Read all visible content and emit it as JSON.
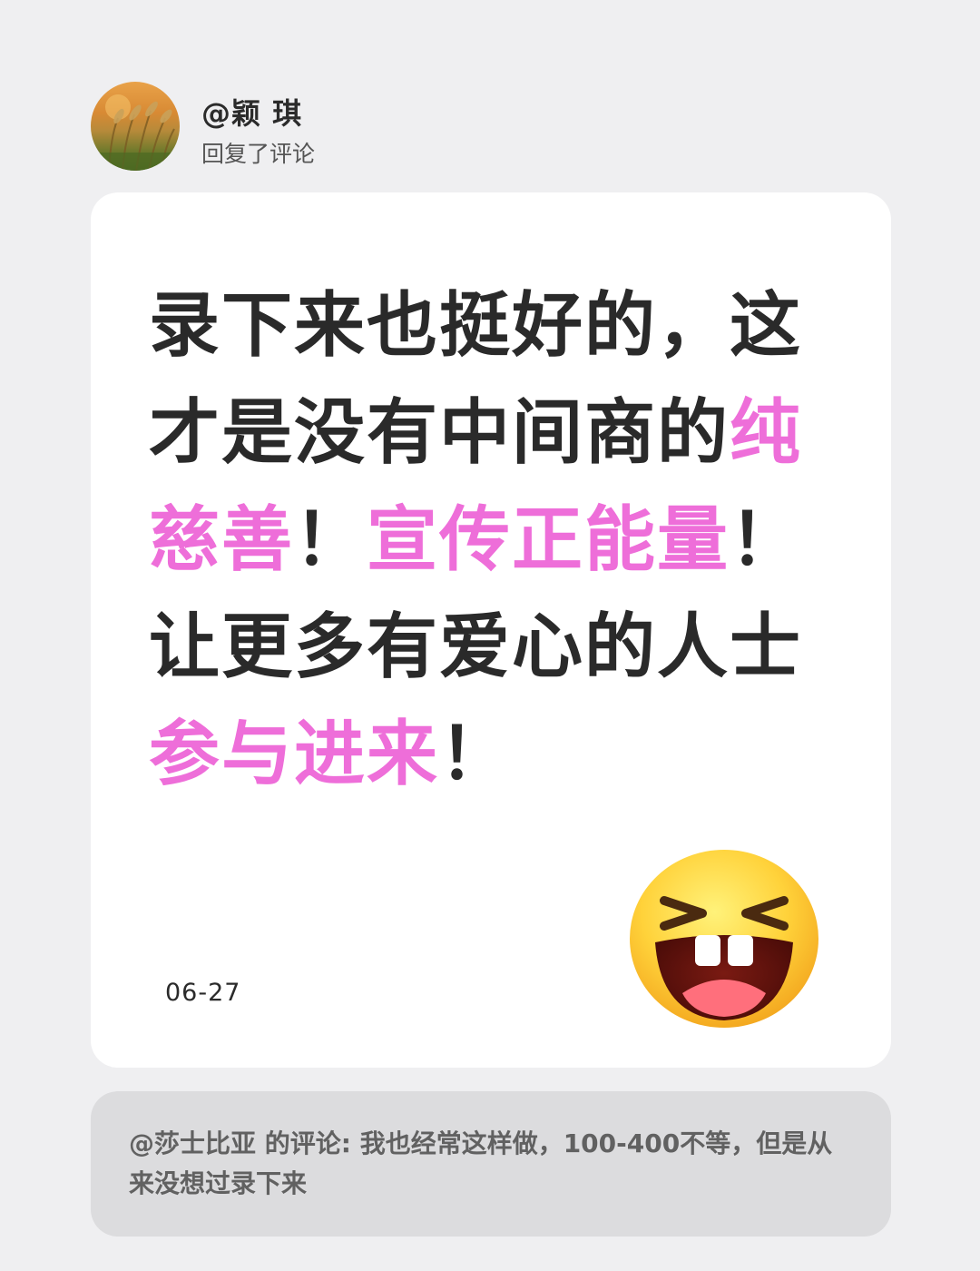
{
  "header": {
    "username": "@颖 琪",
    "action": "回复了评论"
  },
  "comment": {
    "segments": [
      {
        "text": "录下来也挺好的，这才是没有中间商的",
        "highlight": false
      },
      {
        "text": "纯慈善",
        "highlight": true
      },
      {
        "text": "！",
        "highlight": false
      },
      {
        "text": "宣传正能量",
        "highlight": true
      },
      {
        "text": "！让更多有爱心的人士",
        "highlight": false
      },
      {
        "text": "参与进来",
        "highlight": true
      },
      {
        "text": "！",
        "highlight": false
      }
    ],
    "date": "06-27",
    "emoji_icon": "laughing-face-icon"
  },
  "quoted": {
    "text": "@莎士比亚 的评论: 我也经常这样做，100-400不等，但是从来没想过录下来"
  },
  "colors": {
    "background": "#efeff1",
    "card": "#ffffff",
    "text": "#2a2a2a",
    "highlight": "#ee6ed9",
    "quote_background": "#dcdcde",
    "quote_text": "#616161"
  }
}
